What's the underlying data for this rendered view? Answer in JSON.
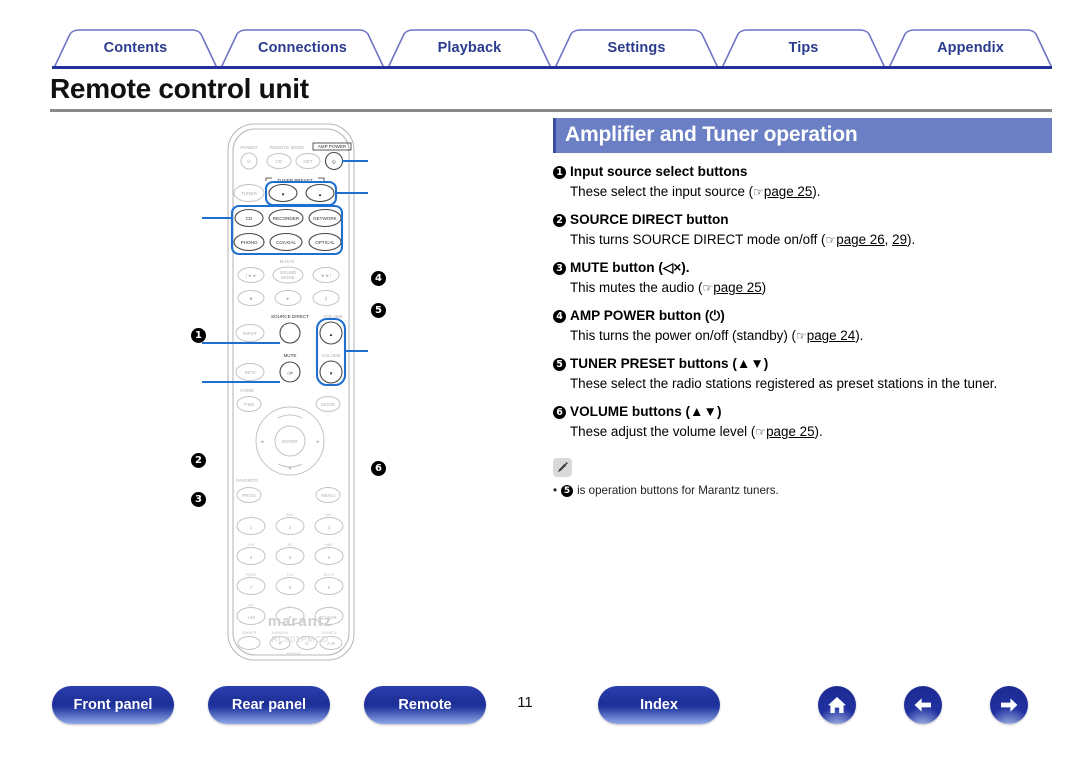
{
  "tabs": [
    {
      "label": "Contents"
    },
    {
      "label": "Connections"
    },
    {
      "label": "Playback"
    },
    {
      "label": "Settings"
    },
    {
      "label": "Tips"
    },
    {
      "label": "Appendix"
    }
  ],
  "page_title": "Remote control unit",
  "section": {
    "heading": "Amplifier and Tuner operation",
    "items": [
      {
        "num": "1",
        "title": "Input source select buttons",
        "body_pre": "These select the input source (",
        "hand": "☞",
        "links": [
          "page 25"
        ],
        "body_post": ")."
      },
      {
        "num": "2",
        "title": "SOURCE DIRECT button",
        "body_pre": "This turns SOURCE DIRECT mode on/off (",
        "hand": "☞",
        "links": [
          "page 26",
          "29"
        ],
        "body_post": ")."
      },
      {
        "num": "3",
        "title": "MUTE button (◁×).",
        "body_pre": "This mutes the audio (",
        "hand": "☞",
        "links": [
          "page 25"
        ],
        "body_post": ")"
      },
      {
        "num": "4",
        "title": "AMP POWER button (⏻)",
        "body_pre": "This turns the power on/off (standby) (",
        "hand": "☞",
        "links": [
          "page 24"
        ],
        "body_post": ")."
      },
      {
        "num": "5",
        "title": "TUNER PRESET buttons (▲▼)",
        "body_pre": "These select the radio stations registered as preset stations in the tuner.",
        "hand": "",
        "links": [],
        "body_post": ""
      },
      {
        "num": "6",
        "title": "VOLUME buttons (▲▼)",
        "body_pre": "These adjust the volume level (",
        "hand": "☞",
        "links": [
          "page 25"
        ],
        "body_post": ")."
      }
    ],
    "note": {
      "icon": "pencil-icon",
      "bullet": "•",
      "num": "5",
      "text": "is operation buttons for Marantz tuners."
    }
  },
  "remote": {
    "brand": "marantz",
    "model": "RC001PMCD",
    "labels": {
      "power": "POWER",
      "remote_mode": "REMOTE MODE",
      "amp_power": "AMP POWER",
      "tuner_preset": "TUNER PRESET",
      "mdax": "M-DAX",
      "source_direct": "SOURCE DIRECT",
      "mute": "MUTE",
      "volume": "VOLUME",
      "home": "HOME",
      "favorite": "FAVORITE",
      "dimmer": "DIMMER",
      "random": "RANDOM",
      "search": "SEARCH",
      "repeat": "REPEAT"
    },
    "buttons": {
      "cd": "CD",
      "net": "NET",
      "tuner": "TUNER",
      "cd2": "CD",
      "recorder": "RECORDER",
      "network": "NETWORK",
      "phono": "PHONO",
      "coaxial": "COAXIAL",
      "optical": "OPTICAL",
      "sound_mode": "SOUND MODE",
      "input": "INPUT",
      "info": "INFO",
      "time": "TIME",
      "mode": "MODE",
      "enter": "ENTER",
      "prog": "PROG",
      "menu": "MENU",
      "clear": "CLEAR",
      "plus10": "+10",
      "ab": "A-B"
    },
    "keypad": [
      {
        "key": "1",
        "sub": ".,/:"
      },
      {
        "key": "2",
        "sub": "ABC"
      },
      {
        "key": "3",
        "sub": "DEF"
      },
      {
        "key": "4",
        "sub": "GHI"
      },
      {
        "key": "5",
        "sub": "JKL"
      },
      {
        "key": "6",
        "sub": "MNO"
      },
      {
        "key": "7",
        "sub": "PQRS"
      },
      {
        "key": "8",
        "sub": "TUV"
      },
      {
        "key": "9",
        "sub": "WXYZ"
      },
      {
        "key": "+10",
        "sub": "a/A"
      },
      {
        "key": "0",
        "sub": "␣-"
      },
      {
        "key": "CLEAR",
        "sub": ""
      }
    ],
    "callouts": [
      "1",
      "2",
      "3",
      "4",
      "5",
      "6"
    ]
  },
  "bottom": {
    "buttons": [
      {
        "label": "Front panel"
      },
      {
        "label": "Rear panel"
      },
      {
        "label": "Remote"
      },
      {
        "label": "Index"
      }
    ],
    "page_number": "11",
    "icons": [
      {
        "name": "home-icon"
      },
      {
        "name": "back-arrow-icon"
      },
      {
        "name": "forward-arrow-icon"
      }
    ]
  }
}
